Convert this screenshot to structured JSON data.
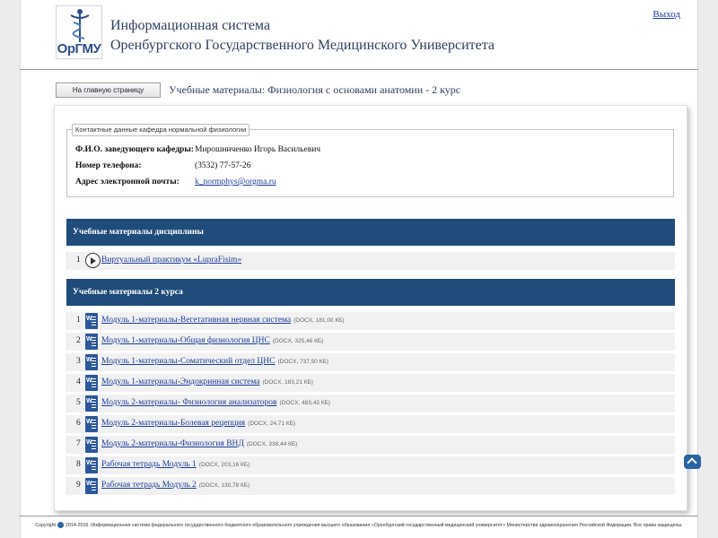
{
  "header": {
    "logo_text": "ОрГМУ",
    "title_line1": "Информационная система",
    "title_line2": "Оренбургского Государственного Медицинского Университета",
    "logout_label": "Выход"
  },
  "nav": {
    "home_button_label": "На главную страницу",
    "page_title": "Учебные материалы: Физиология с основами анатомии - 2 курс"
  },
  "contacts": {
    "legend": "Контактные данные кафедра нормальной физиологии",
    "rows": [
      {
        "label": "Ф.И.О. заведующего кафедры:",
        "value": "Мирошниченко Игорь Васильевич"
      },
      {
        "label": "Номер телефона:",
        "value": "(3532) 77-57-26"
      },
      {
        "label": "Адрес электронной почты:",
        "value": "k_normphys@orgma.ru"
      }
    ]
  },
  "discipline_section": {
    "title": "Учебные материалы дисциплины",
    "items": [
      {
        "num": "1",
        "icon": "play-icon",
        "title": "Виртуальный практикум «LupraFisim»"
      }
    ]
  },
  "course_section": {
    "title": "Учебные материалы 2 курса",
    "items": [
      {
        "num": "1",
        "icon": "docx-icon",
        "title": "Модуль 1-материалы-Вегетативная нервная система",
        "size": "(DOCX, 181,00 КБ)"
      },
      {
        "num": "2",
        "icon": "docx-icon",
        "title": "Модуль 1-материалы-Общая физиология ЦНС",
        "size": "(DOCX, 325,46 КБ)"
      },
      {
        "num": "3",
        "icon": "docx-icon",
        "title": "Модуль 1-материалы-Соматический отдел ЦНС",
        "size": "(DOCX, 737,50 КБ)"
      },
      {
        "num": "4",
        "icon": "docx-icon",
        "title": "Модуль 1-материалы-Эндокринная система",
        "size": "(DOCX, 183,21 КБ)"
      },
      {
        "num": "5",
        "icon": "docx-icon",
        "title": "Модуль 2-материалы- Физиология анализаторов",
        "size": "(DOCX, 483,43 КБ)"
      },
      {
        "num": "6",
        "icon": "docx-icon",
        "title": "Модуль 2-материалы-Болевая рецепция",
        "size": "(DOCX, 24,71 КБ)"
      },
      {
        "num": "7",
        "icon": "docx-icon",
        "title": "Модуль 2-материалы-Физиология ВНД",
        "size": "(DOCX, 338,44 КБ)"
      },
      {
        "num": "8",
        "icon": "docx-icon",
        "title": "Рабочая тетрадь Модуль 1",
        "size": "(DOCX, 203,16 КБ)"
      },
      {
        "num": "9",
        "icon": "docx-icon",
        "title": "Рабочая тетрадь Модуль 2",
        "size": "(DOCX, 130,78 КБ)"
      }
    ]
  },
  "footer": {
    "copyright_label": "Copyright",
    "text": "2014-2016. Информационная система федерального государственного бюджетного образовательного учреждения высшего образования «Оренбургский государственный медицинский университет» Министерства здравоохранения Российской Федерации. Все права защищены."
  },
  "colors": {
    "section_header": "#1f4c7a",
    "link": "#1a3d99",
    "scroll_button": "#2a64a4"
  }
}
